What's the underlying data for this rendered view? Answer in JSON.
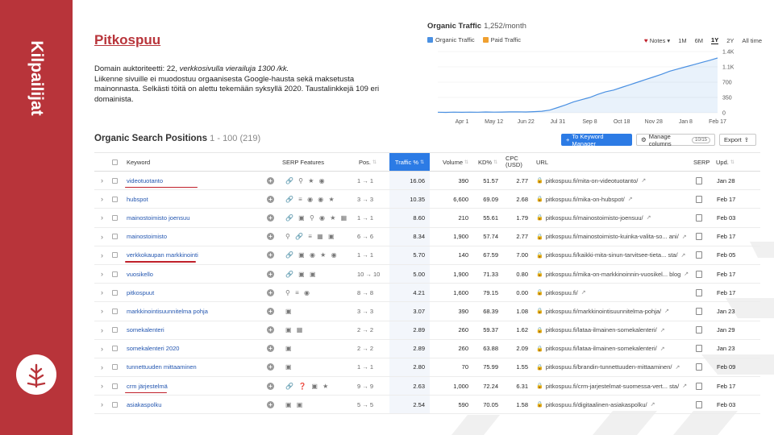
{
  "sidebar": {
    "title": "Kilpailijat"
  },
  "heading": "Pitkospuu",
  "description": {
    "line1_prefix": "Domain auktoriteetti: 22, ",
    "line1_italic": "verkkosivulla vierailuja 1300 /kk.",
    "rest": "Liikenne sivuille ei muodostuu orgaanisesta Google-hausta sekä maksetusta mainonnasta. Selkästi töitä on alettu tekemään syksyllä 2020. Taustalinkkejä 109 eri domainista."
  },
  "traffic_chart": {
    "title": "Organic Traffic",
    "count": "1,252/month",
    "legend": {
      "organic": "Organic Traffic",
      "paid": "Paid Traffic"
    },
    "controls": {
      "notes": "Notes",
      "r1m": "1M",
      "r6m": "6M",
      "r1y": "1Y",
      "r2y": "2Y",
      "all": "All time"
    },
    "colors": {
      "organic": "#4a90e2",
      "paid": "#f0a030"
    }
  },
  "chart_data": {
    "type": "area",
    "x_labels": [
      "Apr 1",
      "May 12",
      "Jun 22",
      "Jul 31",
      "Sep 8",
      "Oct 18",
      "Nov 28",
      "Jan 8",
      "Feb 17"
    ],
    "y_ticks": [
      "1.4K",
      "1.1K",
      "700",
      "350",
      "0"
    ],
    "ylim": [
      0,
      1400
    ],
    "series": [
      {
        "values": [
          12,
          10,
          14,
          11,
          15,
          12,
          18,
          14,
          16,
          20,
          22,
          18,
          25,
          35,
          60,
          120,
          180,
          250,
          300,
          350,
          420,
          480,
          520,
          580,
          640,
          700,
          760,
          820,
          880,
          950,
          1000,
          1050,
          1100,
          1150,
          1200,
          1252
        ]
      }
    ]
  },
  "osp": {
    "title": "Organic Search Positions",
    "range": "1 - 100 (219)",
    "to_keyword_manager": "To Keyword Manager",
    "manage_columns": "Manage columns",
    "manage_badge": "10/15",
    "export": "Export"
  },
  "table": {
    "headers": {
      "keyword": "Keyword",
      "serp_features": "SERP Features",
      "pos": "Pos.",
      "traffic": "Traffic %",
      "volume": "Volume",
      "kd": "KD%",
      "cpc": "CPC (USD)",
      "url": "URL",
      "serp": "SERP",
      "upd": "Upd."
    },
    "rows": [
      {
        "kw": "videotuotanto",
        "pos": "1 → 1",
        "traffic": "16.06",
        "volume": "390",
        "kd": "51.57",
        "cpc": "2.77",
        "url": "pitkospuu.fi/mita-on-videotuotanto/",
        "upd": "Jan 28",
        "feat": "🔗 ⚲ ★ ◉"
      },
      {
        "kw": "hubspot",
        "pos": "3 → 3",
        "traffic": "10.35",
        "volume": "6,600",
        "kd": "69.09",
        "cpc": "2.68",
        "url": "pitkospuu.fi/mika-on-hubspot/",
        "upd": "Feb 17",
        "feat": "🔗 ≡ ◉ ◉ ★"
      },
      {
        "kw": "mainostoimisto joensuu",
        "pos": "1 → 1",
        "traffic": "8.60",
        "volume": "210",
        "kd": "55.61",
        "cpc": "1.79",
        "url": "pitkospuu.fi/mainostoimisto-joensuu/",
        "upd": "Feb 03",
        "feat": "🔗 ▣ ⚲ ◉ ★ ▦"
      },
      {
        "kw": "mainostoimisto",
        "pos": "6 → 6",
        "traffic": "8.34",
        "volume": "1,900",
        "kd": "57.74",
        "cpc": "2.77",
        "url": "pitkospuu.fi/mainostoimisto-kuinka-valita-so... ani/",
        "upd": "Feb 17",
        "feat": "⚲ 🔗 ≡ ▦ ▣"
      },
      {
        "kw": "verkkokaupan markkinointi",
        "pos": "1 → 1",
        "traffic": "5.70",
        "volume": "140",
        "kd": "67.59",
        "cpc": "7.00",
        "url": "pitkospuu.fi/kaikki-mita-sinun-tarvitsee-tieta... sta/",
        "upd": "Feb 05",
        "feat": "🔗 ▣ ◉ ★ ◉"
      },
      {
        "kw": "vuosikello",
        "pos": "10 → 10",
        "traffic": "5.00",
        "volume": "1,900",
        "kd": "71.33",
        "cpc": "0.80",
        "url": "pitkospuu.fi/mika-on-markkinoinnin-vuosikel... blog",
        "upd": "Feb 17",
        "feat": "🔗 ▣ ▣"
      },
      {
        "kw": "pitkospuut",
        "pos": "8 → 8",
        "traffic": "4.21",
        "volume": "1,600",
        "kd": "79.15",
        "cpc": "0.00",
        "url": "pitkospuu.fi/",
        "upd": "Feb 17",
        "feat": "⚲ ≡ ◉"
      },
      {
        "kw": "markkinointisuunnitelma pohja",
        "pos": "3 → 3",
        "traffic": "3.07",
        "volume": "390",
        "kd": "68.39",
        "cpc": "1.08",
        "url": "pitkospuu.fi/markkinointisuunnitelma-pohja/",
        "upd": "Jan 23",
        "feat": "▣"
      },
      {
        "kw": "somekalenteri",
        "pos": "2 → 2",
        "traffic": "2.89",
        "volume": "260",
        "kd": "59.37",
        "cpc": "1.62",
        "url": "pitkospuu.fi/lataa-ilmainen-somekalenteri/",
        "upd": "Jan 29",
        "feat": "▣ ▦"
      },
      {
        "kw": "somekalenteri 2020",
        "pos": "2 → 2",
        "traffic": "2.89",
        "volume": "260",
        "kd": "63.88",
        "cpc": "2.09",
        "url": "pitkospuu.fi/lataa-ilmainen-somekalenteri/",
        "upd": "Jan 23",
        "feat": "▣"
      },
      {
        "kw": "tunnettuuden mittaaminen",
        "pos": "1 → 1",
        "traffic": "2.80",
        "volume": "70",
        "kd": "75.99",
        "cpc": "1.55",
        "url": "pitkospuu.fi/brandin-tunnettuuden-mittaaminen/",
        "upd": "Feb 09",
        "feat": "▣"
      },
      {
        "kw": "crm järjestelmä",
        "pos": "9 → 9",
        "traffic": "2.63",
        "volume": "1,000",
        "kd": "72.24",
        "cpc": "6.31",
        "url": "pitkospuu.fi/crm-jarjestelmat-suomessa-vert... sta/",
        "upd": "Feb 17",
        "feat": "🔗 ❓ ▣ ★"
      },
      {
        "kw": "asiakaspolku",
        "pos": "5 → 5",
        "traffic": "2.54",
        "volume": "590",
        "kd": "70.05",
        "cpc": "1.58",
        "url": "pitkospuu.fi/digitaalinen-asiakaspolku/",
        "upd": "Feb 03",
        "feat": "▣ ▣"
      }
    ]
  }
}
